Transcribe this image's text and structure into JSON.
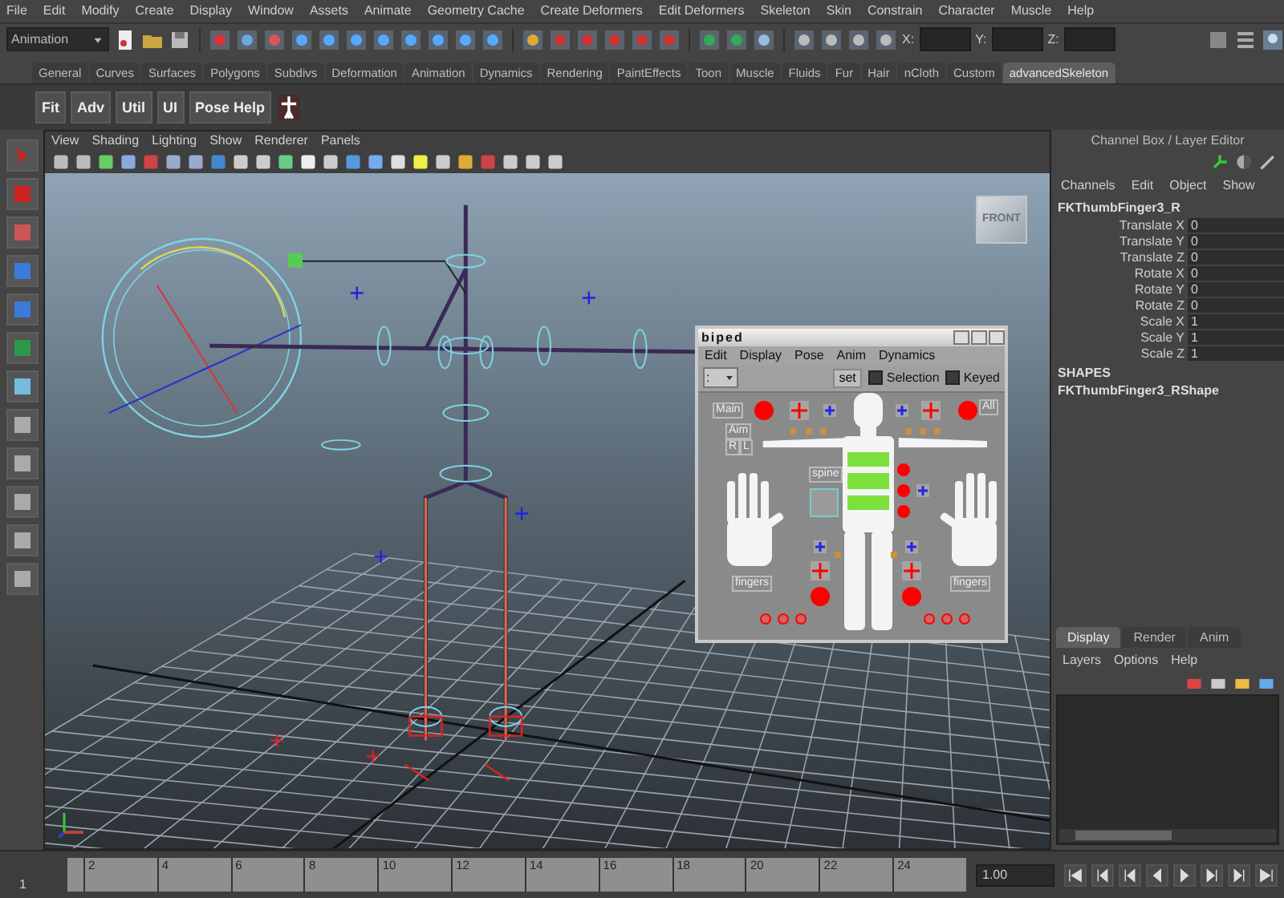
{
  "menubar": [
    "File",
    "Edit",
    "Modify",
    "Create",
    "Display",
    "Window",
    "Assets",
    "Animate",
    "Geometry Cache",
    "Create Deformers",
    "Edit Deformers",
    "Skeleton",
    "Skin",
    "Constrain",
    "Character",
    "Muscle",
    "Help"
  ],
  "status_line": {
    "mode": "Animation",
    "x_label": "X:",
    "y_label": "Y:",
    "z_label": "Z:"
  },
  "shelf": {
    "tabs": [
      {
        "label": "General",
        "selected": false
      },
      {
        "label": "Curves",
        "selected": false
      },
      {
        "label": "Surfaces",
        "selected": false
      },
      {
        "label": "Polygons",
        "selected": false
      },
      {
        "label": "Subdivs",
        "selected": false
      },
      {
        "label": "Deformation",
        "selected": false
      },
      {
        "label": "Animation",
        "selected": false
      },
      {
        "label": "Dynamics",
        "selected": false
      },
      {
        "label": "Rendering",
        "selected": false
      },
      {
        "label": "PaintEffects",
        "selected": false
      },
      {
        "label": "Toon",
        "selected": false
      },
      {
        "label": "Muscle",
        "selected": false
      },
      {
        "label": "Fluids",
        "selected": false
      },
      {
        "label": "Fur",
        "selected": false
      },
      {
        "label": "Hair",
        "selected": false
      },
      {
        "label": "nCloth",
        "selected": false
      },
      {
        "label": "Custom",
        "selected": false
      },
      {
        "label": "advancedSkeleton",
        "selected": true
      }
    ],
    "buttons": [
      "Fit",
      "Adv",
      "Util",
      "UI",
      "Pose Help"
    ]
  },
  "viewport": {
    "menu": [
      "View",
      "Shading",
      "Lighting",
      "Show",
      "Renderer",
      "Panels"
    ],
    "view_cube": "FRONT"
  },
  "biped": {
    "title": "biped",
    "menu": [
      "Edit",
      "Display",
      "Pose",
      "Anim",
      "Dynamics"
    ],
    "selector": ":",
    "set_button": "set",
    "checkboxes": [
      {
        "label": "Selection",
        "checked": false
      },
      {
        "label": "Keyed",
        "checked": false
      }
    ],
    "labels": {
      "main": "Main",
      "all": "All",
      "aim": "Aim",
      "right": "R",
      "left": "L",
      "spine": "spine",
      "fingers_right": "fingers",
      "fingers_left": "fingers"
    }
  },
  "channel_box": {
    "title": "Channel Box / Layer Editor",
    "menu": [
      "Channels",
      "Edit",
      "Object",
      "Show"
    ],
    "object": "FKThumbFinger3_R",
    "attributes": [
      {
        "name": "Translate X",
        "value": "0"
      },
      {
        "name": "Translate Y",
        "value": "0"
      },
      {
        "name": "Translate Z",
        "value": "0"
      },
      {
        "name": "Rotate X",
        "value": "0"
      },
      {
        "name": "Rotate Y",
        "value": "0"
      },
      {
        "name": "Rotate Z",
        "value": "0"
      },
      {
        "name": "Scale X",
        "value": "1"
      },
      {
        "name": "Scale Y",
        "value": "1"
      },
      {
        "name": "Scale Z",
        "value": "1"
      }
    ],
    "shapes_heading": "SHAPES",
    "shape": "FKThumbFinger3_RShape"
  },
  "layer_editor": {
    "tabs": [
      {
        "label": "Display",
        "selected": true
      },
      {
        "label": "Render",
        "selected": false
      },
      {
        "label": "Anim",
        "selected": false
      }
    ],
    "menu": [
      "Layers",
      "Options",
      "Help"
    ]
  },
  "timeline": {
    "start": "1",
    "ticks": [
      "2",
      "4",
      "6",
      "8",
      "10",
      "12",
      "14",
      "16",
      "18",
      "20",
      "22",
      "24"
    ],
    "current_frame": "1.00"
  }
}
